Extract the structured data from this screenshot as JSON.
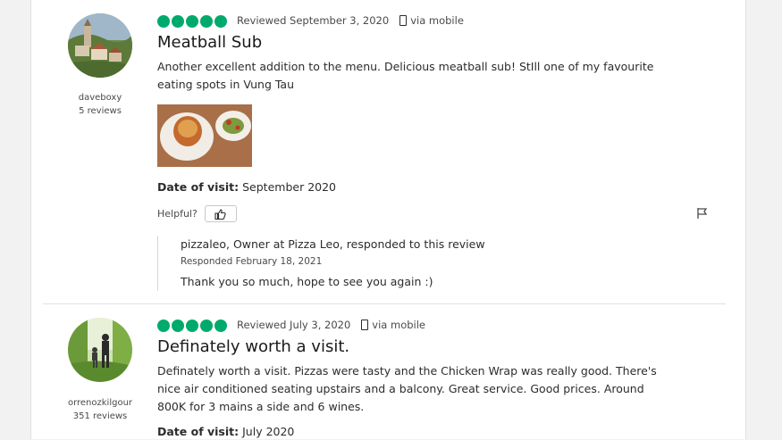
{
  "reviews": [
    {
      "username": "daveboxy",
      "review_count": "5 reviews",
      "rating": 5,
      "reviewed_date": "Reviewed September 3, 2020",
      "via": "via mobile",
      "title": "Meatball Sub",
      "text": "Another excellent addition to the menu. Delicious meatball sub! StIll one of my favourite eating spots in Vung Tau",
      "date_of_visit_label": "Date of visit:",
      "date_of_visit": "September 2020",
      "helpful_label": "Helpful?",
      "response": {
        "title": "pizzaleo, Owner at Pizza Leo, responded to this review",
        "date": "Responded February 18, 2021",
        "text": "Thank you so much, hope to see you again :)"
      }
    },
    {
      "username": "orrenozkilgour",
      "review_count": "351 reviews",
      "rating": 5,
      "reviewed_date": "Reviewed July 3, 2020",
      "via": "via mobile",
      "title": "Definately worth a visit.",
      "text": "Definately worth a visit. Pizzas were tasty and the Chicken Wrap was really good. There's nice air conditioned seating upstairs and a balcony. Great service. Good prices. Around 800K for 3 mains a side and 6 wines.",
      "date_of_visit_label": "Date of visit:",
      "date_of_visit": "July 2020"
    }
  ],
  "colors": {
    "rating_green": "#00aa6c"
  },
  "icons": {
    "helpful": "thumbs-up-icon",
    "report": "flag-icon",
    "mobile": "mobile-phone-icon"
  }
}
